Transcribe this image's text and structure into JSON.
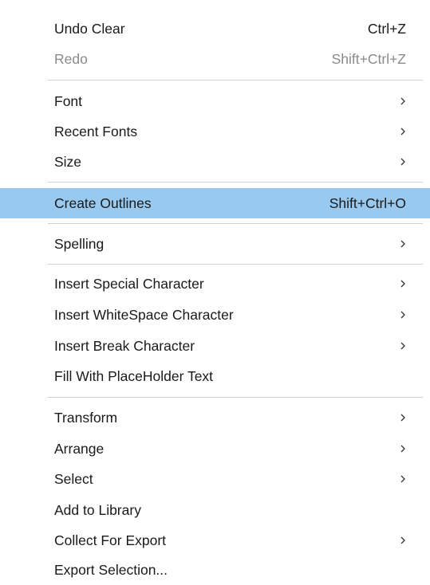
{
  "menu": {
    "undo_clear": {
      "label": "Undo Clear",
      "shortcut": "Ctrl+Z"
    },
    "redo": {
      "label": "Redo",
      "shortcut": "Shift+Ctrl+Z"
    },
    "font": {
      "label": "Font"
    },
    "recent_fonts": {
      "label": "Recent Fonts"
    },
    "size": {
      "label": "Size"
    },
    "create_outlines": {
      "label": "Create Outlines",
      "shortcut": "Shift+Ctrl+O"
    },
    "spelling": {
      "label": "Spelling"
    },
    "insert_special_character": {
      "label": "Insert Special Character"
    },
    "insert_whitespace_character": {
      "label": "Insert WhiteSpace Character"
    },
    "insert_break_character": {
      "label": "Insert Break Character"
    },
    "fill_with_placeholder_text": {
      "label": "Fill With PlaceHolder Text"
    },
    "transform": {
      "label": "Transform"
    },
    "arrange": {
      "label": "Arrange"
    },
    "select": {
      "label": "Select"
    },
    "add_to_library": {
      "label": "Add to Library"
    },
    "collect_for_export": {
      "label": "Collect For Export"
    },
    "export_selection": {
      "label": "Export Selection..."
    }
  },
  "colors": {
    "highlight": "#99c9ef",
    "disabled_text": "#8a8a8a",
    "separator": "#cfcfcf"
  },
  "icons": {
    "submenu": "chevron-right-icon"
  }
}
